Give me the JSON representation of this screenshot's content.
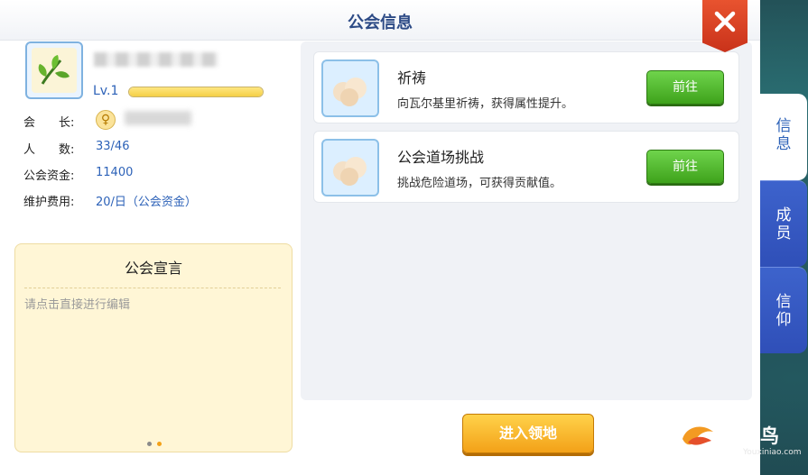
{
  "window": {
    "title": "公会信息",
    "close_icon": "close-icon"
  },
  "guild": {
    "level": "Lv.1",
    "exp_fraction": 1.0,
    "leader_label": "会　　长:",
    "members_label": "人　　数:",
    "members_value": "33/46",
    "funds_label": "公会资金:",
    "funds_value": "11400",
    "upkeep_label": "维护费用:",
    "upkeep_value": "20/日（公会资金）"
  },
  "manifesto": {
    "title": "公会宣言",
    "placeholder": "请点击直接进行编辑"
  },
  "activities": [
    {
      "title": "祈祷",
      "desc": "向瓦尔基里祈祷，获得属性提升。",
      "button": "前往"
    },
    {
      "title": "公会道场挑战",
      "desc": "挑战危险道场，可获得贡献值。",
      "button": "前往"
    }
  ],
  "enter_button": "进入领地",
  "tabs": [
    {
      "label": "信\n息",
      "active": true
    },
    {
      "label": "成\n员",
      "active": false
    },
    {
      "label": "信\n仰",
      "active": false
    }
  ],
  "watermark": {
    "text": "游戏鸟",
    "sub": "Youxiniao.com"
  },
  "colors": {
    "accent_blue": "#2d62b8",
    "go_button": "#3ea21b",
    "enter_button": "#f3a118",
    "close_button": "#c9321a",
    "tab_active": "#ffffff",
    "tab_inactive": "#2f4fb8"
  }
}
